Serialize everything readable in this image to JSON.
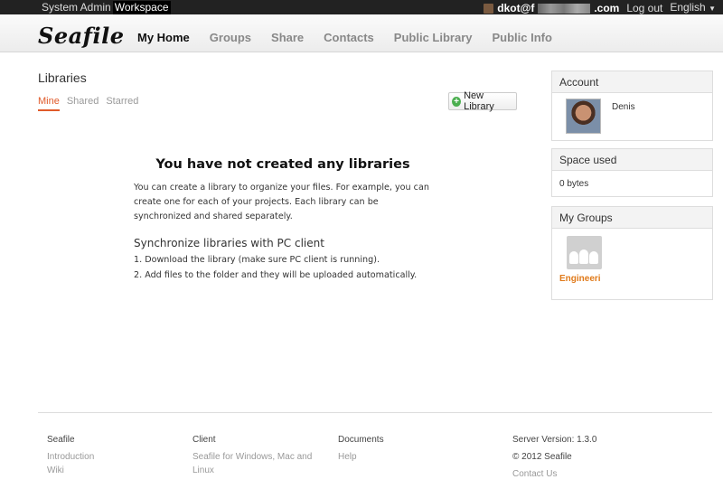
{
  "topbar": {
    "left": [
      "System Admin",
      "Workspace"
    ],
    "user": "dkot@f",
    "user_suffix": ".com",
    "logout": "Log out",
    "language": "English"
  },
  "header": {
    "logo": "Seafile",
    "nav": [
      "My Home",
      "Groups",
      "Share",
      "Contacts",
      "Public Library",
      "Public Info"
    ]
  },
  "main": {
    "title": "Libraries",
    "tabs": [
      "Mine",
      "Shared",
      "Starred"
    ],
    "new_library": "New Library",
    "empty_title": "You have not created any libraries",
    "empty_desc": "You can create a library to organize your files. For example, you can create one for each of your projects. Each library can be synchronized and shared separately.",
    "sync_title": "Synchronize libraries with PC client",
    "steps": [
      "1. Download the library (make sure PC client is running).",
      "2. Add files to the folder and they will be uploaded automatically."
    ]
  },
  "sidebar": {
    "account_title": "Account",
    "username": "Denis",
    "space_title": "Space used",
    "space_value": "0 bytes",
    "groups_title": "My Groups",
    "group_name": "Engineeri"
  },
  "footer": {
    "col1": {
      "title": "Seafile",
      "links": [
        "Introduction",
        "Wiki"
      ]
    },
    "col2": {
      "title": "Client",
      "links": [
        "Seafile for Windows, Mac and Linux"
      ]
    },
    "col3": {
      "title": "Documents",
      "links": [
        "Help"
      ]
    },
    "col4": {
      "version": "Server Version: 1.3.0",
      "copyright": "© 2012 Seafile",
      "contact": "Contact Us"
    }
  }
}
